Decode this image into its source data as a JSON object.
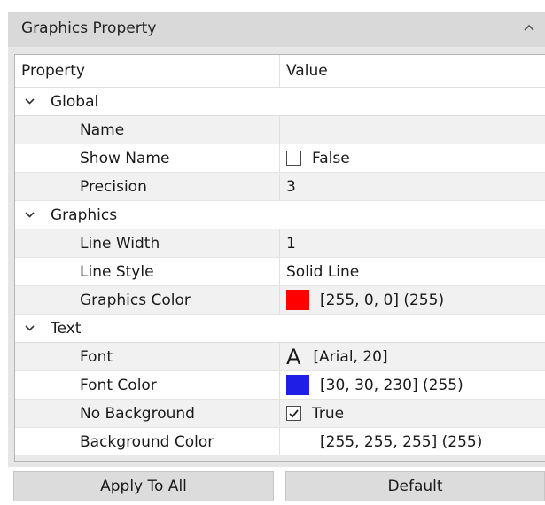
{
  "panel": {
    "title": "Graphics Property"
  },
  "grid": {
    "header": {
      "property": "Property",
      "value": "Value"
    },
    "categories": [
      {
        "label": "Global",
        "rows": [
          {
            "name": "Name",
            "value": ""
          },
          {
            "name": "Show Name",
            "value": "False",
            "checked": false
          },
          {
            "name": "Precision",
            "value": "3"
          }
        ]
      },
      {
        "label": "Graphics",
        "rows": [
          {
            "name": "Line Width",
            "value": "1"
          },
          {
            "name": "Line Style",
            "value": "Solid Line"
          },
          {
            "name": "Graphics Color",
            "value": "[255, 0, 0] (255)",
            "swatch": "#ff0000"
          }
        ]
      },
      {
        "label": "Text",
        "rows": [
          {
            "name": "Font",
            "value": "[Arial, 20]",
            "glyph": "A"
          },
          {
            "name": "Font Color",
            "value": "[30, 30, 230] (255)",
            "swatch": "#1e1ee6"
          },
          {
            "name": "No Background",
            "value": "True",
            "checked": true
          },
          {
            "name": "Background Color",
            "value": "[255, 255, 255] (255)",
            "swatch": "#ffffff"
          }
        ]
      }
    ]
  },
  "buttons": {
    "apply": "Apply To All",
    "default": "Default"
  },
  "icons": {
    "collapse": "chevron-up-icon",
    "expand": "chevron-down-icon",
    "check": "check-icon"
  }
}
